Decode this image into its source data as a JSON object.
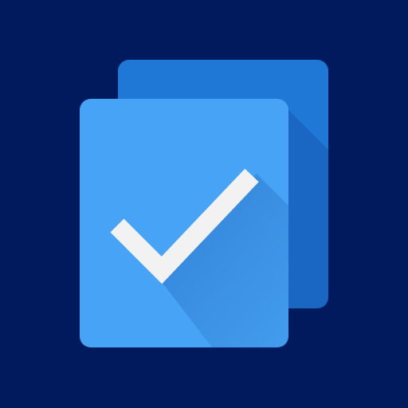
{
  "icon": {
    "name": "stacked-pages-checkmark",
    "colors": {
      "background": "#001a5e",
      "back_page": "#1f78d6",
      "front_page": "#47a3f5",
      "check": "#f2f2f2",
      "shadow": "#0d47a1"
    }
  }
}
